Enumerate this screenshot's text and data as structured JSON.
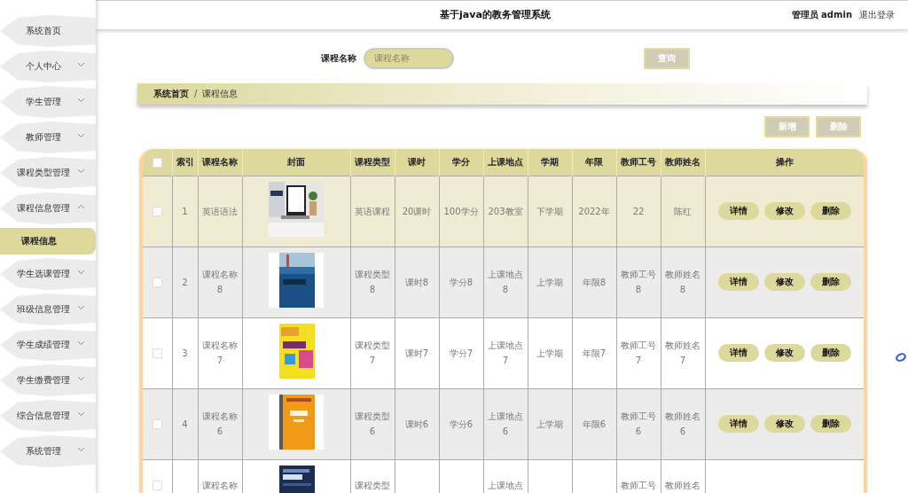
{
  "sidebar": {
    "items": [
      {
        "label": "系统首页",
        "kind": "link"
      },
      {
        "label": "个人中心",
        "kind": "group",
        "expanded": false
      },
      {
        "label": "学生管理",
        "kind": "group",
        "expanded": false
      },
      {
        "label": "教师管理",
        "kind": "group",
        "expanded": false
      },
      {
        "label": "课程类型管理",
        "kind": "group",
        "expanded": false
      },
      {
        "label": "课程信息管理",
        "kind": "group",
        "expanded": true,
        "children": [
          {
            "label": "课程信息",
            "selected": true
          }
        ]
      },
      {
        "label": "学生选课管理",
        "kind": "group",
        "expanded": false
      },
      {
        "label": "班级信息管理",
        "kind": "group",
        "expanded": false
      },
      {
        "label": "学生成绩管理",
        "kind": "group",
        "expanded": false
      },
      {
        "label": "学生缴费管理",
        "kind": "group",
        "expanded": false
      },
      {
        "label": "综合信息管理",
        "kind": "group",
        "expanded": false
      },
      {
        "label": "系统管理",
        "kind": "group",
        "expanded": false
      }
    ]
  },
  "header": {
    "title": "基于java的教务管理系统",
    "user": "管理员 admin",
    "logout": "退出登录"
  },
  "search": {
    "label": "课程名称",
    "placeholder": "课程名称",
    "button": "查询"
  },
  "breadcrumb": {
    "items": [
      "系统首页",
      "课程信息"
    ],
    "separator": "/"
  },
  "actions": [
    "新增",
    "删除"
  ],
  "table": {
    "header_checked": false,
    "columns": [
      "",
      "索引",
      "课程名称",
      "封面",
      "课程类型",
      "课时",
      "学分",
      "上课地点",
      "学期",
      "年限",
      "教师工号",
      "教师姓名",
      "操作"
    ],
    "rows": [
      {
        "checked": false,
        "cells": [
          "",
          "1",
          "英语语法",
          "",
          "英语课程",
          "20课时",
          "100学分",
          "203教室",
          "下学期",
          "2022年",
          "22",
          "陈红",
          ""
        ],
        "actions": [
          "详情",
          "修改",
          "删除"
        ]
      },
      {
        "checked": false,
        "cells": [
          "",
          "2",
          "课程名称8",
          "",
          "课程类型8",
          "课时8",
          "学分8",
          "上课地点8",
          "上学期",
          "年限8",
          "教师工号8",
          "教师姓名8",
          ""
        ],
        "actions": [
          "详情",
          "修改",
          "删除"
        ]
      },
      {
        "checked": false,
        "cells": [
          "",
          "3",
          "课程名称7",
          "",
          "课程类型7",
          "课时7",
          "学分7",
          "上课地点7",
          "上学期",
          "年限7",
          "教师工号7",
          "教师姓名7",
          ""
        ],
        "actions": [
          "详情",
          "修改",
          "删除"
        ]
      },
      {
        "checked": false,
        "cells": [
          "",
          "4",
          "课程名称6",
          "",
          "课程类型6",
          "课时6",
          "学分6",
          "上课地点6",
          "上学期",
          "年限6",
          "教师工号6",
          "教师姓名6",
          ""
        ],
        "actions": [
          "详情",
          "修改",
          "删除"
        ]
      },
      {
        "checked": false,
        "cells": [
          "",
          "",
          "课程名称",
          "",
          "课程类型",
          "",
          "",
          "上课地点",
          "",
          "",
          "教师工号",
          "教师姓名",
          ""
        ]
      }
    ]
  }
}
